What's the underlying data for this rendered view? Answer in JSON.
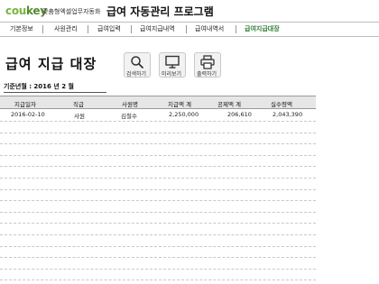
{
  "header": {
    "logo_main": "cou",
    "logo_accent": "key",
    "tagline": "맞춤형엑셀업무자동화",
    "app_title": "급여 자동관리 프로그램"
  },
  "nav": {
    "tabs": [
      "기본정보",
      "사원관리",
      "급여입력",
      "급여지급내역",
      "급여내역서",
      "급여지급대장"
    ],
    "active_index": 5
  },
  "page": {
    "title": "급여 지급 대장"
  },
  "toolbar": {
    "search_label": "검색하기",
    "preview_label": "미리보기",
    "print_label": "출력하기"
  },
  "filter": {
    "text": "기준년월 : 2016 년  2 월"
  },
  "table": {
    "columns": [
      "지급일자",
      "직급",
      "사원명",
      "지급액 계",
      "공제액 계",
      "실수령액"
    ],
    "rows": [
      [
        "2016-02-10",
        "사원",
        "김철수",
        "2,250,000",
        "206,610",
        "2,043,390"
      ]
    ]
  },
  "colors": {
    "accent": "#7cb342",
    "active_tab": "#2e7d32"
  }
}
